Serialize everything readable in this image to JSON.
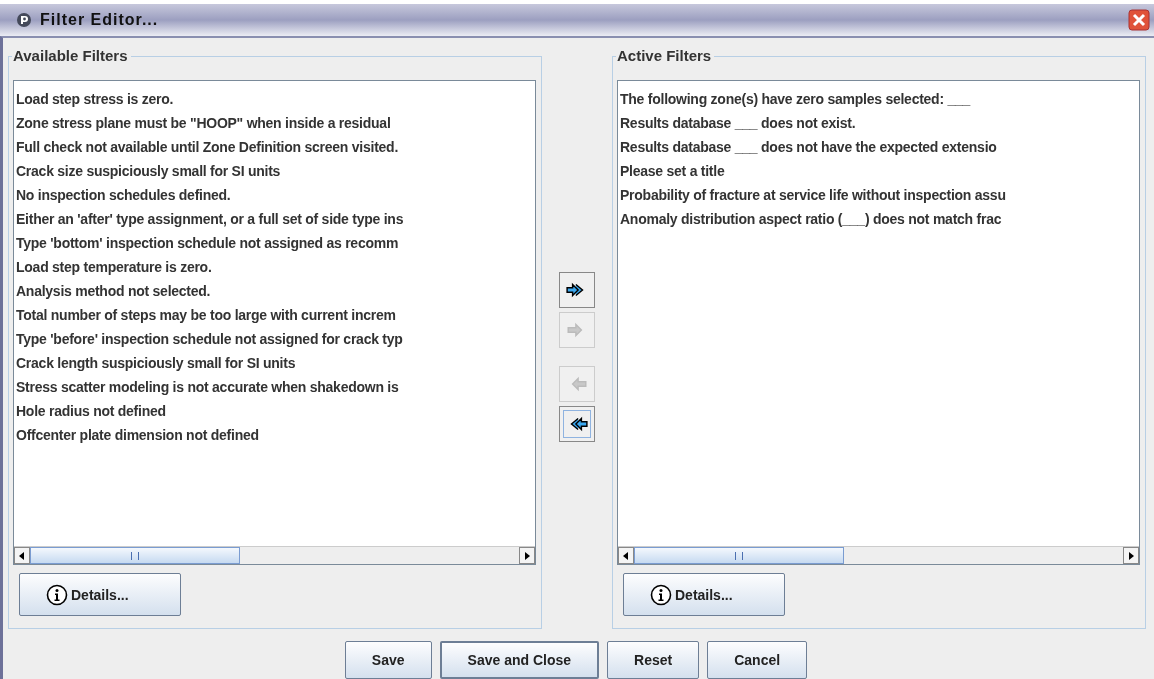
{
  "window": {
    "title": "Filter Editor..."
  },
  "available": {
    "title": "Available Filters",
    "items": [
      "Load step stress is zero.",
      "Zone stress plane must be \"HOOP\" when inside a residual",
      "Full check not available until Zone Definition screen visited.",
      "Crack size suspiciously small for SI units",
      "No inspection schedules defined.",
      "Either an 'after' type assignment, or a full set of side type ins",
      "Type 'bottom' inspection schedule not assigned as recomm",
      "Load step temperature is zero.",
      "Analysis method not selected.",
      "Total number of steps may be too large with current increm",
      "Type 'before' inspection schedule not assigned for crack typ",
      "Crack length suspiciously small for SI units",
      "Stress scatter modeling is not accurate when shakedown is",
      "Hole radius not defined",
      "Offcenter plate dimension not defined"
    ],
    "details_button": "Details..."
  },
  "move_buttons": [
    {
      "kind": "add-all",
      "disabled": false,
      "focused": false
    },
    {
      "kind": "add",
      "disabled": true,
      "focused": false
    },
    {
      "kind": "remove",
      "disabled": true,
      "focused": false
    },
    {
      "kind": "remove-all",
      "disabled": false,
      "focused": true
    }
  ],
  "active": {
    "title": "Active Filters",
    "items": [
      "The following zone(s) have zero samples selected: ___",
      "Results database ___ does not exist.",
      "Results database ___ does not have the expected extensio",
      "Please set a title",
      "Probability of fracture at service life without inspection assu",
      "Anomaly distribution aspect ratio (___) does not match frac"
    ],
    "details_button": "Details..."
  },
  "buttons": [
    {
      "label": "Save",
      "default": false
    },
    {
      "label": "Save and Close",
      "default": true
    },
    {
      "label": "Reset",
      "default": false
    },
    {
      "label": "Cancel",
      "default": false
    }
  ]
}
